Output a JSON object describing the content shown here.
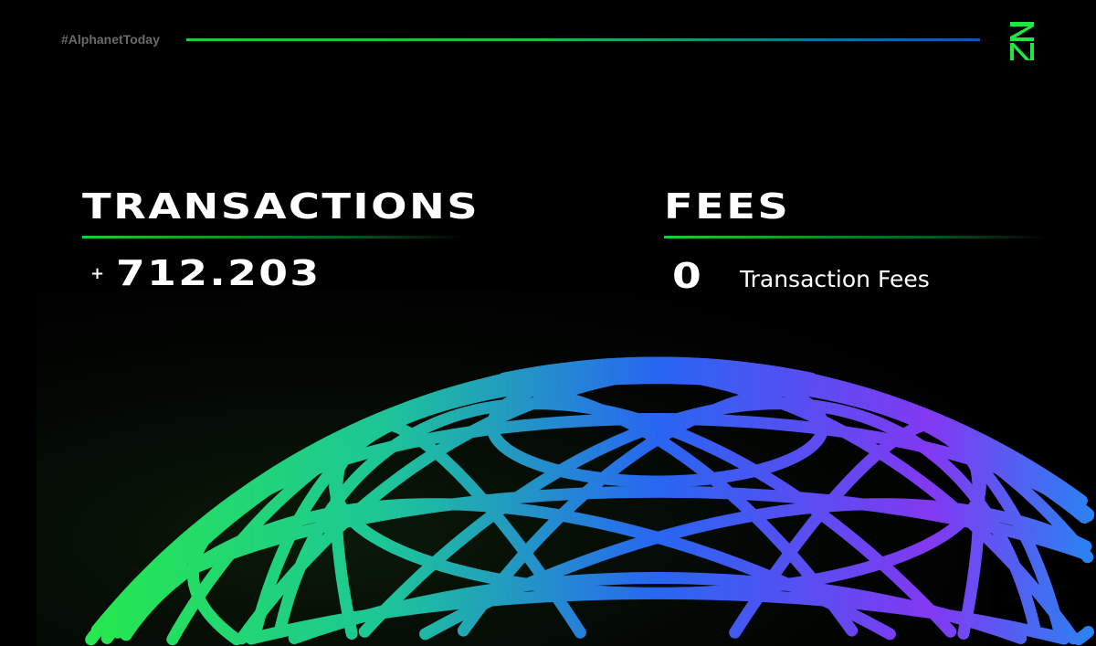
{
  "header": {
    "hashtag": "#AlphanetToday",
    "logo": "zn-logo",
    "accent_green": "#16d13a",
    "accent_blue": "#1552b8"
  },
  "stats": {
    "transactions": {
      "title": "TRANSACTIONS",
      "prefix": "+",
      "value": "712.203"
    },
    "fees": {
      "title": "FEES",
      "value": "0",
      "label": "Transaction Fees"
    }
  },
  "image": {
    "subject": "wireframe-sphere-graphic"
  }
}
